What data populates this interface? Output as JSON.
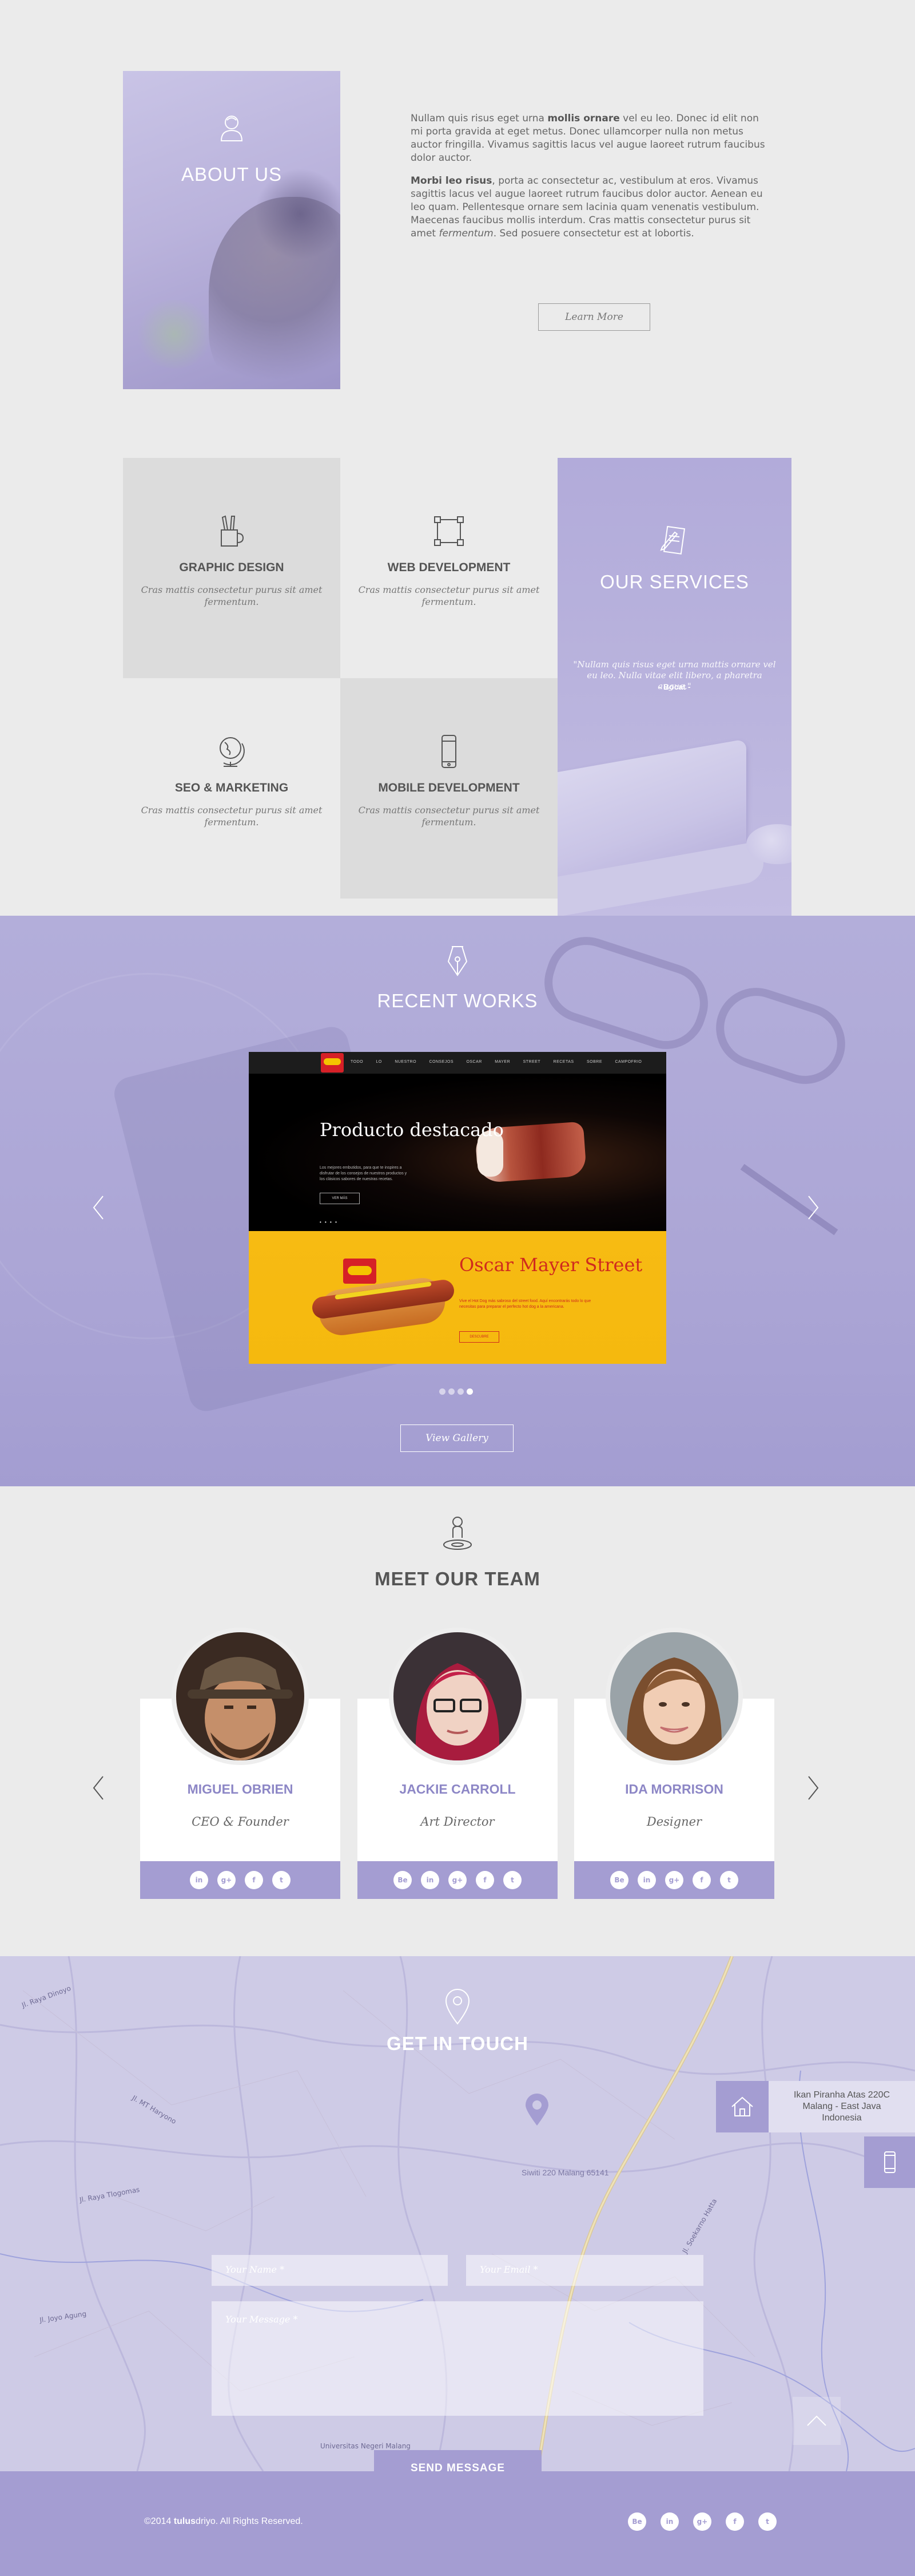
{
  "about": {
    "title": "ABOUT US",
    "p1_lead": "Nullam quis risus eget urna ",
    "p1_bold": "mollis ornare",
    "p1_rest": " vel eu leo. Donec id elit non mi porta gravida at eget metus. Donec ullamcorper nulla non metus auctor fringilla. Vivamus sagittis lacus vel augue laoreet rutrum faucibus dolor auctor.",
    "p2_bold": "Morbi leo risus",
    "p2_rest": ", porta ac consectetur ac, vestibulum at eros. Vivamus sagittis lacus vel augue laoreet rutrum faucibus dolor auctor. Aenean eu leo quam. Pellentesque ornare sem lacinia quam venenatis vestibulum. Maecenas faucibus mollis interdum. Cras mattis consectetur purus sit amet ",
    "p2_em": "fermentum",
    "p2_end": ". Sed posuere consectetur est at lobortis.",
    "button": "Learn More"
  },
  "services": {
    "title": "OUR SERVICES",
    "quote": "\"Nullam quis risus eget urna mattis ornare vel eu leo. Nulla vitae elit libero, a pharetra augue.\"",
    "quote_author": "- Bocat -",
    "items": [
      {
        "title": "GRAPHIC DESIGN",
        "desc": "Cras mattis consectetur purus sit amet fermentum.",
        "icon": "pencil-cup-icon"
      },
      {
        "title": "WEB DEVELOPMENT",
        "desc": "Cras mattis consectetur purus sit amet fermentum.",
        "icon": "vector-square-icon"
      },
      {
        "title": "SEO & MARKETING",
        "desc": "Cras mattis consectetur purus sit amet fermentum.",
        "icon": "globe-icon"
      },
      {
        "title": "MOBILE DEVELOPMENT",
        "desc": "Cras mattis consectetur purus sit amet fermentum.",
        "icon": "smartphone-icon"
      }
    ]
  },
  "works": {
    "title": "RECENT WORKS",
    "button": "View Gallery",
    "slide": {
      "nav": "TODO LO NUESTRO   CONSEJOS   OSCAR MAYER STREET   RECETAS   SOBRE CAMPOFRIO",
      "hero_title": "Producto destacado",
      "hero_text": "Los mejores embutidos, para que te inspires a disfrutar de los consejos de nuestros productos y los clásicos sabores de nuestras recetas.",
      "hero_button": "VER MÁS",
      "promo_title": "Oscar Mayer Street",
      "promo_text": "Vive el Hot Dog más sabroso del street food. Aquí encontrarás todo lo que necesitas para preparar el perfecto hot dog a la americana.",
      "promo_button": "DESCUBRE"
    }
  },
  "team": {
    "title": "MEET OUR TEAM",
    "members": [
      {
        "name": "MIGUEL OBRIEN",
        "role": "CEO & Founder"
      },
      {
        "name": "JACKIE CARROLL",
        "role": "Art Director"
      },
      {
        "name": "IDA MORRISON",
        "role": "Designer"
      }
    ]
  },
  "contact": {
    "title": "GET IN TOUCH",
    "address_line1": "Ikan Piranha Atas 220C",
    "address_line2": "Malang - East Java",
    "address_line3": "Indonesia",
    "map_label": "Siwiti 220 Malang 65141",
    "name_placeholder": "Your Name *",
    "email_placeholder": "Your Email *",
    "message_placeholder": "Your Message *",
    "send": "SEND MESSAGE"
  },
  "footer": {
    "copy_prefix": "©2014 ",
    "copy_brand": "tulus",
    "copy_brand2": "driyo",
    "copy_rest": ". All Rights Reserved."
  },
  "colors": {
    "accent": "#a49dd2",
    "accent_text": "#8d87c6",
    "background": "#ebebeb"
  }
}
